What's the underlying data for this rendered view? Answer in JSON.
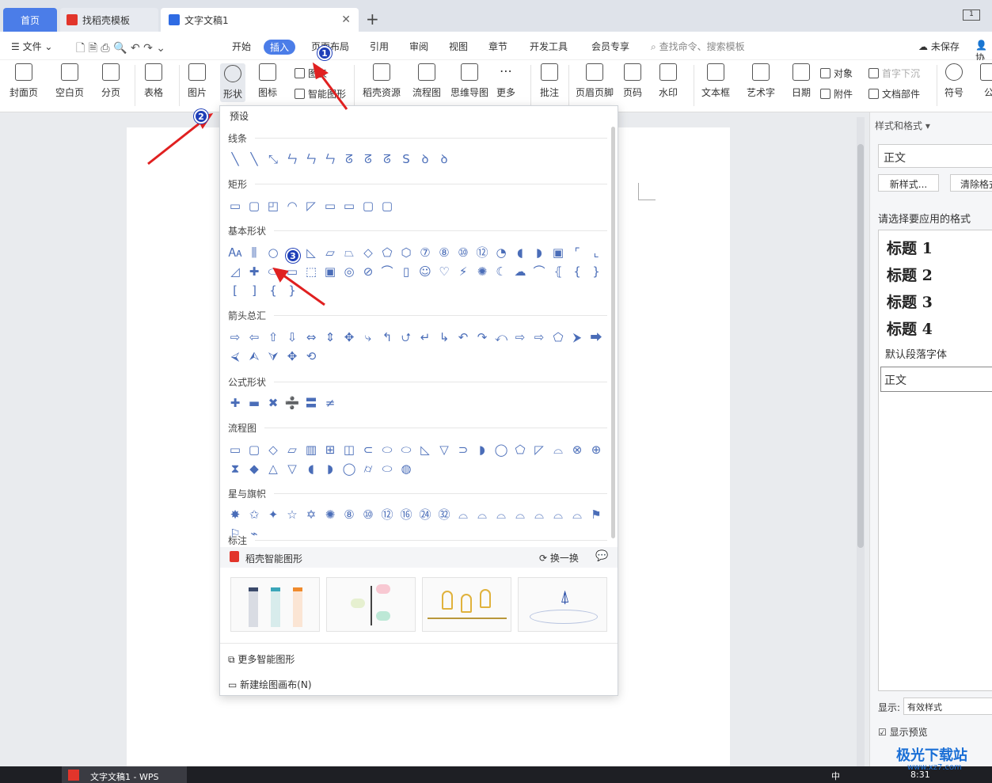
{
  "tabs": {
    "home": "首页",
    "template": "找稻壳模板",
    "doc": "文字文稿1",
    "new_tab": "+"
  },
  "menu": {
    "file": "文件",
    "items": [
      "开始",
      "插入",
      "页面布局",
      "引用",
      "审阅",
      "视图",
      "章节",
      "开发工具",
      "会员专享"
    ],
    "search": "查找命令、搜索模板",
    "unsaved": "未保存",
    "collab": "协"
  },
  "ribbon": {
    "cover": "封面页",
    "blank": "空白页",
    "pagebreak": "分页",
    "table": "表格",
    "picture": "图片",
    "shape": "形状",
    "icon": "图标",
    "chart": "图表",
    "smart": "智能图形",
    "daoke": "稻壳资源",
    "flow": "流程图",
    "mind": "思维导图",
    "more": "更多",
    "comment": "批注",
    "header": "页眉页脚",
    "pagenum": "页码",
    "watermark": "水印",
    "textbox": "文本框",
    "arttext": "艺术字",
    "date": "日期",
    "object": "对象",
    "attach": "附件",
    "dropcap": "首字下沉",
    "docpart": "文档部件",
    "symbol": "符号",
    "formula": "公"
  },
  "dropdown": {
    "title": "预设",
    "sections": [
      "线条",
      "矩形",
      "基本形状",
      "箭头总汇",
      "公式形状",
      "流程图",
      "星与旗帜",
      "标注"
    ],
    "smart_title": "稻壳智能图形",
    "refresh": "换一换",
    "more_smart": "更多智能图形",
    "new_canvas": "新建绘图画布(N)",
    "shapes": {
      "lines": [
        "╲",
        "╲",
        "⤡",
        "ㄣ",
        "ㄣ",
        "ㄣ",
        "ᘔ",
        "ᘔ",
        "ᘔ",
        "S",
        "ꝺ",
        "ꝺ"
      ],
      "rects": [
        "▭",
        "▢",
        "◰",
        "◠",
        "◸",
        "▭",
        "▭",
        "▢",
        "▢"
      ],
      "basic": [
        "🗛",
        "⫼",
        "○",
        "△",
        "◺",
        "▱",
        "⏢",
        "◇",
        "⬠",
        "⬡",
        "⑦",
        "⑧",
        "⑩",
        "⑫",
        "◔",
        "◖",
        "◗",
        "▣",
        "⌜",
        "⌞",
        "◿",
        "✚",
        "⬭",
        "▭",
        "⬚",
        "▣",
        "◎",
        "⊘",
        "⌒",
        "▯",
        "☺",
        "♡",
        "⚡",
        "✺",
        "☾",
        "☁",
        "⌒",
        "⦃",
        "{",
        "}",
        "[",
        "]",
        "{",
        "}"
      ],
      "arrows": [
        "⇨",
        "⇦",
        "⇧",
        "⇩",
        "⇔",
        "⇕",
        "✥",
        "⤷",
        "↰",
        "⮍",
        "↵",
        "↳",
        "↶",
        "↷",
        "⤺",
        "⇨",
        "⇨",
        "⬠",
        "⮞",
        "⮕",
        "⮘",
        "⮙",
        "⮛",
        "✥",
        "⟲"
      ],
      "formula": [
        "✚",
        "▬",
        "✖",
        "➗",
        "〓",
        "≠"
      ],
      "flow": [
        "▭",
        "▢",
        "◇",
        "▱",
        "▥",
        "⊞",
        "◫",
        "⊂",
        "⬭",
        "⬭",
        "◺",
        "▽",
        "⊃",
        "◗",
        "◯",
        "⬠",
        "◸",
        "⌓",
        "⊗",
        "⊕",
        "⧗",
        "◆",
        "△",
        "▽",
        "◖",
        "◗",
        "◯",
        "⌭",
        "⬭",
        "◍"
      ],
      "stars": [
        "✸",
        "✩",
        "✦",
        "☆",
        "✡",
        "✺",
        "⑧",
        "⑩",
        "⑫",
        "⑯",
        "㉔",
        "㉜",
        "⌓",
        "⌓",
        "⌓",
        "⌓",
        "⌓",
        "⌓",
        "⌓",
        "⚑",
        "⚐",
        "⌁"
      ]
    }
  },
  "right_panel": {
    "title": "样式和格式",
    "current": "正文",
    "new_style": "新样式...",
    "clear": "清除格式",
    "choose": "请选择要应用的格式",
    "styles": [
      "标题  1",
      "标题  2",
      "标题  3",
      "标题  4"
    ],
    "default_font": "默认段落字体",
    "normal": "正文",
    "show_label": "显示:",
    "show_value": "有效样式",
    "preview": "显示预览"
  },
  "annotations": [
    "1",
    "2",
    "3"
  ],
  "taskbar": {
    "app": "文字文稿1 - WPS",
    "time": "8:31",
    "ime": "中",
    "watermark": "极光下载站",
    "site": "www.xz7.com"
  }
}
